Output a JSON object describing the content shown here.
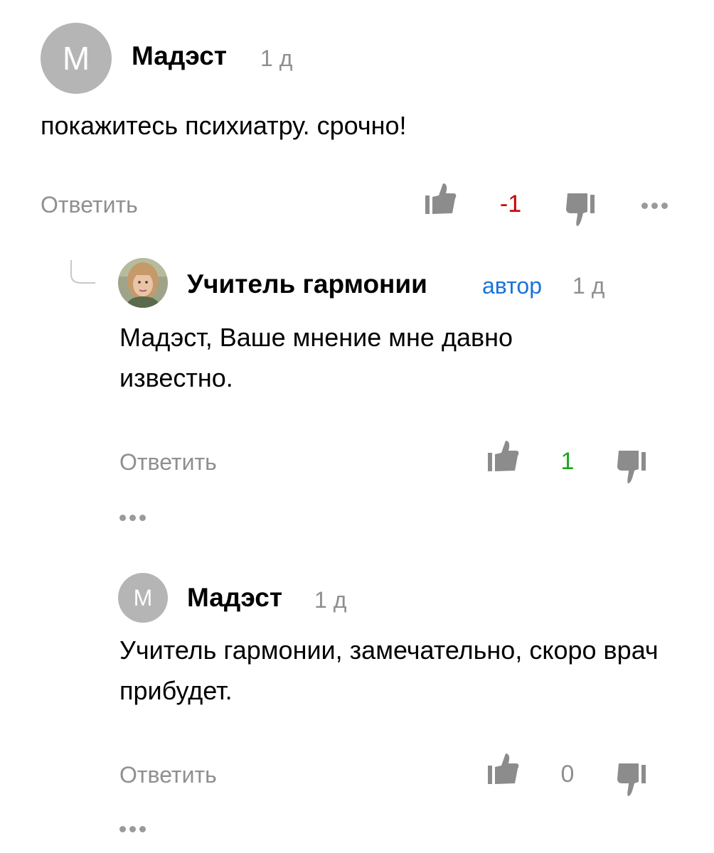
{
  "comments": [
    {
      "avatar_letter": "М",
      "author": "Мадэст",
      "time": "1 д",
      "text": "покажитесь психиатру. срочно!",
      "reply_label": "Ответить",
      "score": "-1",
      "score_color": "#cc0000"
    },
    {
      "author": "Учитель гармонии",
      "badge": "автор",
      "time": "1 д",
      "text": "Мадэст, Ваше мнение мне давно известно.",
      "reply_label": "Ответить",
      "score": "1",
      "score_color": "#1aa81a"
    },
    {
      "avatar_letter": "М",
      "author": "Мадэст",
      "time": "1 д",
      "text": "Учитель гармонии, замечательно, скоро врач прибудет.",
      "reply_label": "Ответить",
      "score": "0",
      "score_color": "#8f8f8f"
    }
  ],
  "icons": {
    "like": "thumbs-up-icon",
    "dislike": "thumbs-down-icon",
    "more": "more-dots-icon",
    "reply_branch": "thread-branch-icon"
  },
  "colors": {
    "avatar_bg": "#b5b5b5",
    "muted_text": "#8f8f8f",
    "author_badge": "#1a73d9",
    "icon": "#8c8c8c"
  }
}
